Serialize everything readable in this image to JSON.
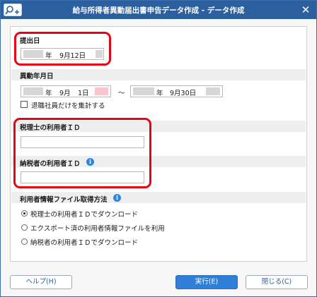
{
  "window": {
    "title": "給与所得者異動届出書申告データ作成 - データ作成",
    "close_symbol": "✕"
  },
  "submit_date": {
    "label": "提出日",
    "year_suffix": "年",
    "month_day": "9月12日"
  },
  "change_period": {
    "label": "異動年月日",
    "from": {
      "year_suffix": "年",
      "month": "9月",
      "day": "1日"
    },
    "separator": "〜",
    "to": {
      "year_suffix": "年",
      "month_day": "9月30日"
    },
    "retired_only_label": "退職社員だけを集計する",
    "retired_only_checked": false
  },
  "tax_accountant_user_id": {
    "label": "税理士の利用者ＩＤ",
    "value": ""
  },
  "taxpayer_user_id": {
    "label": "納税者の利用者ＩＤ",
    "value": "",
    "info_icon": "i"
  },
  "user_info_method": {
    "label": "利用者情報ファイル取得方法",
    "info_icon": "i",
    "options": [
      {
        "label": "税理士の利用者ＩＤでダウンロード",
        "selected": true
      },
      {
        "label": "エクスポート済の利用者情報ファイルを利用",
        "selected": false
      },
      {
        "label": "納税者の利用者ＩＤでダウンロード",
        "selected": false
      }
    ]
  },
  "buttons": {
    "help": "ヘルプ(H)",
    "run": "実行(E)",
    "close": "閉じる(C)"
  },
  "colors": {
    "titlebar": "#2c5f9e",
    "highlight": "#e30613",
    "primary_button": "#2f7fd8"
  }
}
